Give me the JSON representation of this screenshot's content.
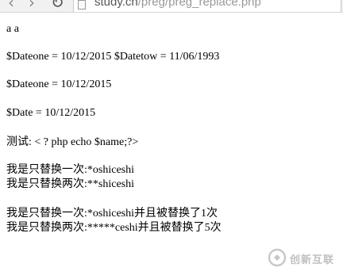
{
  "browser": {
    "url_host": "study.cn",
    "url_path": "/preg/preg_replace.php"
  },
  "output": {
    "line1": "a a",
    "line2": "$Dateone = 10/12/2015 $Datetow = 11/06/1993",
    "line3": "$Dateone = 10/12/2015",
    "line4": "$Date = 10/12/2015",
    "line5": "测试: < ? php echo $name;?>",
    "line6": "我是只替换一次:*oshiceshi",
    "line7": "我是只替换两次:**shiceshi",
    "line8": "我是只替换一次:*oshiceshi并且被替换了1次",
    "line9": "我是只替换两次:*****ceshi并且被替换了5次"
  },
  "watermark": {
    "text": "创新互联"
  }
}
